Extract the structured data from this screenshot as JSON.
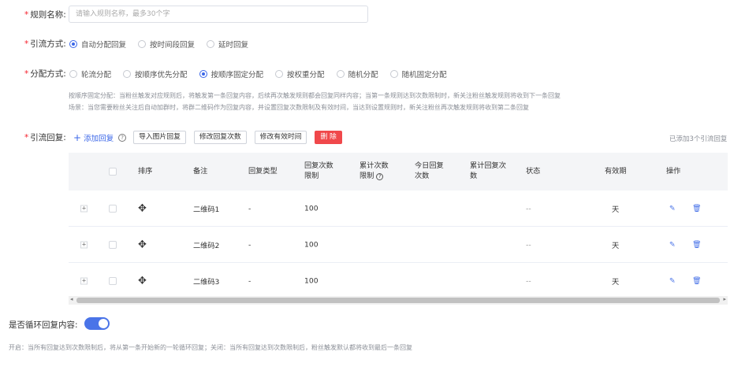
{
  "rule_name": {
    "label": "规则名称",
    "placeholder": "请输入规则名称，最多30个字"
  },
  "diversion_method": {
    "label": "引流方式",
    "options": [
      "自动分配回复",
      "按时间段回复",
      "延时回复"
    ],
    "selected_index": 0
  },
  "allocation_method": {
    "label": "分配方式",
    "options": [
      "轮流分配",
      "按顺序优先分配",
      "按顺序固定分配",
      "按权重分配",
      "随机分配",
      "随机固定分配"
    ],
    "selected_index": 2,
    "hint_line1": "按顺序固定分配：当粉丝触发对应规则后，将触发第一条回复内容，后续再次触发规则都会回复同样内容；当第一条规则达到次数限制时，新关注粉丝触发规则将收到下一条回复",
    "hint_line2": "场景：当您需要粉丝关注后自动加群时，将群二维码作为回复内容，并设置回复次数限制及有效时间，当达到设置规则时，新关注粉丝再次触发规则将收到第二条回复"
  },
  "reply": {
    "label": "引流回复",
    "add_label": "添加回复",
    "buttons": {
      "import": "导入图片回复",
      "edit_count": "修改回复次数",
      "edit_time": "修改有效时间",
      "delete": "删 除"
    },
    "added_note": "已添加3个引流回复"
  },
  "table": {
    "headers": {
      "order": "排序",
      "note": "备注",
      "type": "回复类型",
      "limit_line1": "回复次数",
      "limit_line2": "限制",
      "total_line1": "累计次数",
      "total_line2": "限制",
      "today_line1": "今日回复",
      "today_line2": "次数",
      "cum_line1": "累计回复次",
      "cum_line2": "数",
      "status": "状态",
      "validity": "有效期",
      "actions": "操作"
    },
    "rows": [
      {
        "note": "二维码1",
        "type": "-",
        "limit": "100",
        "status": "--",
        "validity": "天"
      },
      {
        "note": "二维码2",
        "type": "-",
        "limit": "100",
        "status": "--",
        "validity": "天"
      },
      {
        "note": "二维码3",
        "type": "-",
        "limit": "100",
        "status": "--",
        "validity": "天"
      }
    ]
  },
  "loop": {
    "label": "是否循环回复内容",
    "enabled": true,
    "hint": "开启：当所有回复达到次数限制后，将从第一条开始新的一轮循环回复；关闭：当所有回复达到次数限制后，粉丝触发默认都将收到最后一条回复"
  },
  "colors": {
    "accent": "#3b67e8",
    "danger": "#f0484b",
    "required": "#f5222d",
    "toggle": "#4a74e8"
  },
  "icons": [
    "help-icon",
    "plus-icon",
    "move-icon",
    "edit-icon",
    "delete-icon",
    "expand-icon"
  ]
}
